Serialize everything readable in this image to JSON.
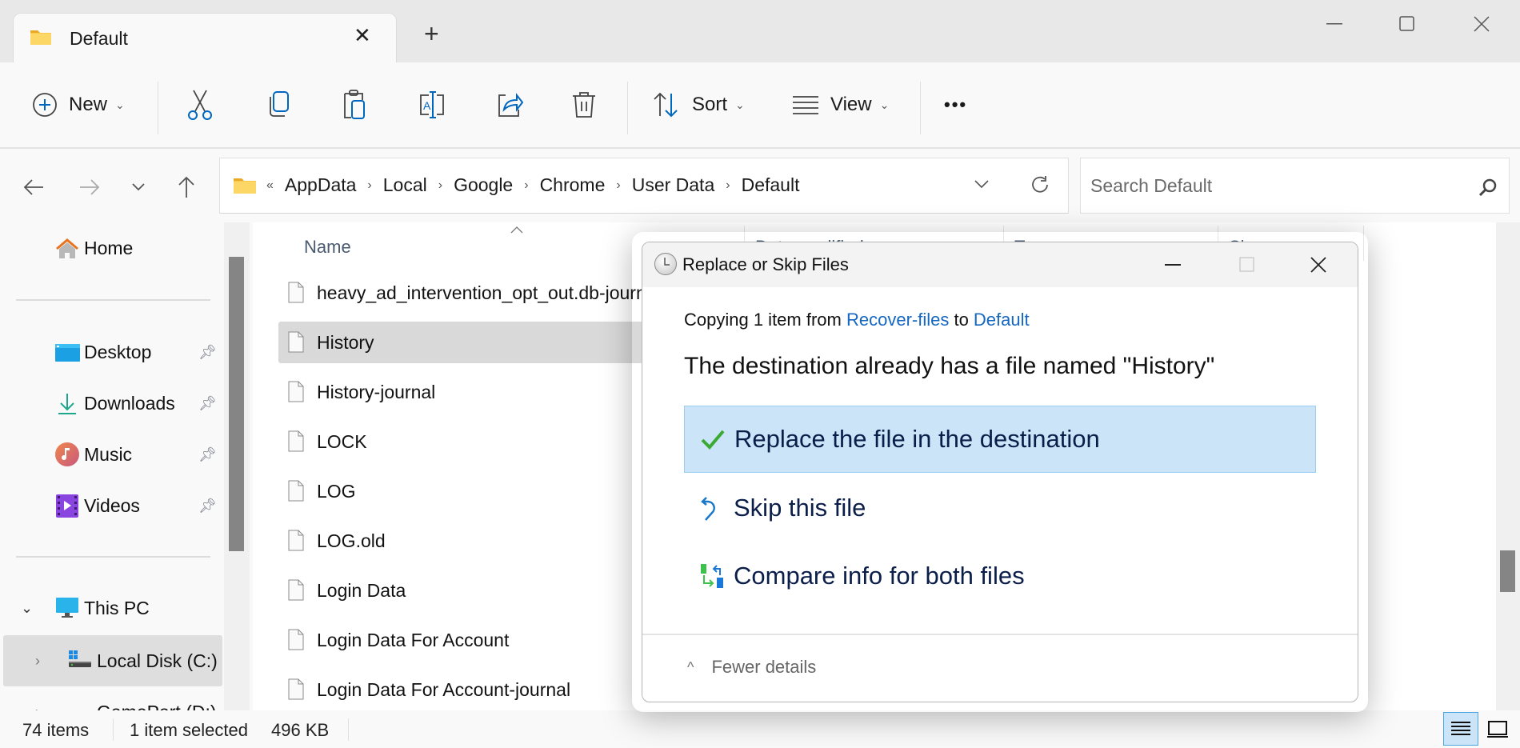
{
  "window": {
    "tab_title": "Default",
    "new_tab_label": "+",
    "controls": [
      "minimize",
      "maximize",
      "close"
    ]
  },
  "toolbar": {
    "new_label": "New",
    "icons": [
      "cut-icon",
      "copy-icon",
      "paste-icon",
      "rename-icon",
      "share-icon",
      "delete-icon"
    ],
    "sort_label": "Sort",
    "view_label": "View",
    "more_label": "•••"
  },
  "address": {
    "overflow": "«",
    "crumbs": [
      "AppData",
      "Local",
      "Google",
      "Chrome",
      "User Data",
      "Default"
    ]
  },
  "search": {
    "placeholder": "Search Default",
    "value": ""
  },
  "sidebar": {
    "home": "Home",
    "pinned": [
      {
        "label": "Desktop",
        "icon": "desktop-icon"
      },
      {
        "label": "Downloads",
        "icon": "downloads-icon"
      },
      {
        "label": "Music",
        "icon": "music-icon"
      },
      {
        "label": "Videos",
        "icon": "videos-icon"
      }
    ],
    "this_pc": "This PC",
    "drives": [
      {
        "label": "Local Disk (C:)",
        "selected": true
      },
      {
        "label": "GamePart (D:)",
        "selected": false
      }
    ]
  },
  "filelist": {
    "columns": [
      "Name",
      "Date modified",
      "Type",
      "Size"
    ],
    "files": [
      {
        "name": "heavy_ad_intervention_opt_out.db-journal",
        "selected": false
      },
      {
        "name": "History",
        "selected": true
      },
      {
        "name": "History-journal",
        "selected": false
      },
      {
        "name": "LOCK",
        "selected": false
      },
      {
        "name": "LOG",
        "selected": false
      },
      {
        "name": "LOG.old",
        "selected": false
      },
      {
        "name": "Login Data",
        "selected": false
      },
      {
        "name": "Login Data For Account",
        "selected": false
      },
      {
        "name": "Login Data For Account-journal",
        "selected": false
      }
    ]
  },
  "status": {
    "item_count": "74 items",
    "selection": "1 item selected",
    "size": "496 KB"
  },
  "dialog": {
    "title": "Replace or Skip Files",
    "copying_prefix": "Copying 1 item from ",
    "source": "Recover-files",
    "to": " to ",
    "destination": "Default",
    "heading": "The destination already has a file named \"History\"",
    "options": [
      {
        "label": "Replace the file in the destination",
        "icon": "check-icon",
        "highlighted": true
      },
      {
        "label": "Skip this file",
        "icon": "skip-icon",
        "highlighted": false
      },
      {
        "label": "Compare info for both files",
        "icon": "compare-icon",
        "highlighted": false
      }
    ],
    "fewer_details": "Fewer details"
  },
  "colors": {
    "accent": "#0067c0",
    "link": "#1567c0",
    "highlight_bg": "#cce4f7",
    "selected_row": "#d9d9d9"
  }
}
